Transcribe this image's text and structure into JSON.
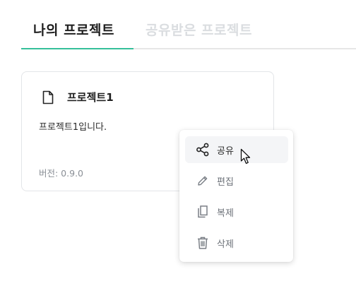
{
  "tabs": {
    "mine_label": "나의 프로젝트",
    "shared_label": "공유받은 프로젝트",
    "active_color": "#35c09a"
  },
  "project_card": {
    "icon": "document-icon",
    "title": "프로젝트1",
    "description": "프로젝트1입니다.",
    "version": "버전: 0.9.0"
  },
  "context_menu": {
    "items": [
      {
        "icon": "share-icon",
        "label": "공유"
      },
      {
        "icon": "pencil-icon",
        "label": "편집"
      },
      {
        "icon": "copy-icon",
        "label": "복제"
      },
      {
        "icon": "trash-icon",
        "label": "삭제"
      }
    ]
  }
}
